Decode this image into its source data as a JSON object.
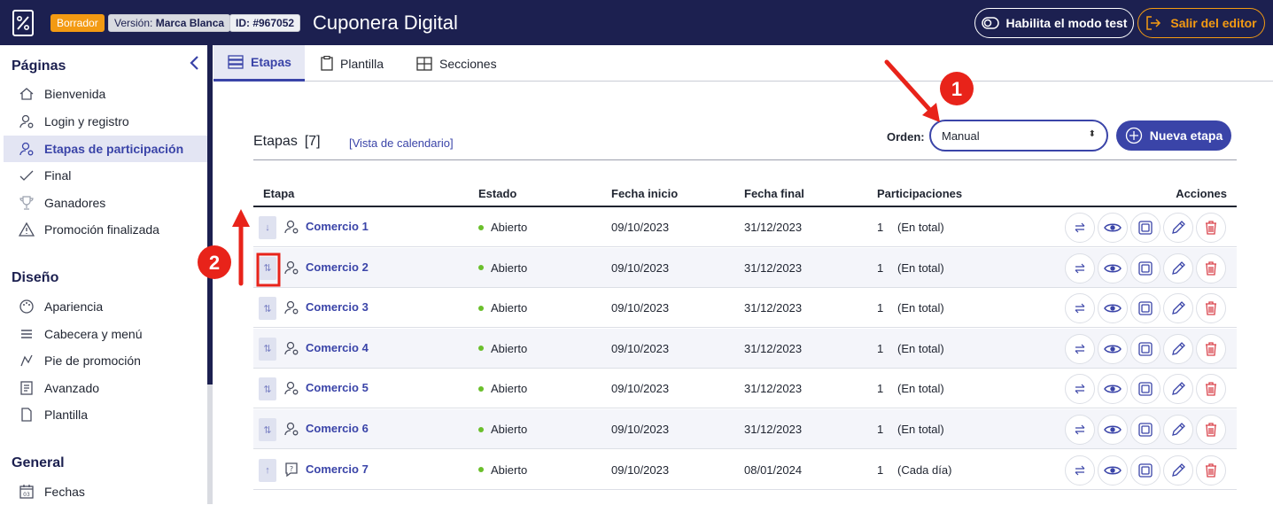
{
  "topbar": {
    "badge_draft": "Borrador",
    "badge_version_prefix": "Versión: ",
    "badge_version_value": "Marca Blanca",
    "badge_id": "ID: #967052",
    "app_title": "Cuponera Digital",
    "test_mode_label": "Habilita el modo test",
    "exit_label": "Salir del editor"
  },
  "sidebar": {
    "sections": [
      {
        "title": "Páginas"
      },
      {
        "title": "Diseño"
      },
      {
        "title": "General"
      }
    ],
    "pages": [
      {
        "label": "Bienvenida",
        "icon": "home-icon"
      },
      {
        "label": "Login y registro",
        "icon": "user-settings-icon"
      },
      {
        "label": "Etapas de participación",
        "icon": "user-settings-icon"
      },
      {
        "label": "Final",
        "icon": "check-icon"
      },
      {
        "label": "Ganadores",
        "icon": "trophy-icon"
      },
      {
        "label": "Promoción finalizada",
        "icon": "warning-icon"
      }
    ],
    "design": [
      {
        "label": "Apariencia",
        "icon": "palette-icon"
      },
      {
        "label": "Cabecera y menú",
        "icon": "menu-icon"
      },
      {
        "label": "Pie de promoción",
        "icon": "footer-icon"
      },
      {
        "label": "Avanzado",
        "icon": "code-icon"
      },
      {
        "label": "Plantilla",
        "icon": "file-icon"
      }
    ],
    "general": [
      {
        "label": "Fechas",
        "icon": "calendar-icon"
      }
    ],
    "calendar_day": "03"
  },
  "tabs": [
    {
      "label": "Etapas",
      "icon": "list-icon"
    },
    {
      "label": "Plantilla",
      "icon": "clipboard-icon"
    },
    {
      "label": "Secciones",
      "icon": "grid-icon"
    }
  ],
  "main": {
    "heading": "Etapas",
    "count": "[7]",
    "calendar_link": "[Vista de calendario]",
    "order_label": "Orden:",
    "order_value": "Manual",
    "new_button": "Nueva etapa"
  },
  "table": {
    "headers": [
      "Etapa",
      "Estado",
      "Fecha inicio",
      "Fecha final",
      "Participaciones",
      "Acciones"
    ],
    "rows": [
      {
        "name": "Comercio 1",
        "status": "Abierto",
        "start": "09/10/2023",
        "end": "31/12/2023",
        "count": "1",
        "scope": "(En total)",
        "handle": "↓",
        "icon": "user-settings-icon"
      },
      {
        "name": "Comercio 2",
        "status": "Abierto",
        "start": "09/10/2023",
        "end": "31/12/2023",
        "count": "1",
        "scope": "(En total)",
        "handle": "⇅",
        "icon": "user-settings-icon"
      },
      {
        "name": "Comercio 3",
        "status": "Abierto",
        "start": "09/10/2023",
        "end": "31/12/2023",
        "count": "1",
        "scope": "(En total)",
        "handle": "⇅",
        "icon": "user-settings-icon"
      },
      {
        "name": "Comercio 4",
        "status": "Abierto",
        "start": "09/10/2023",
        "end": "31/12/2023",
        "count": "1",
        "scope": "(En total)",
        "handle": "⇅",
        "icon": "user-settings-icon"
      },
      {
        "name": "Comercio 5",
        "status": "Abierto",
        "start": "09/10/2023",
        "end": "31/12/2023",
        "count": "1",
        "scope": "(En total)",
        "handle": "⇅",
        "icon": "user-settings-icon"
      },
      {
        "name": "Comercio 6",
        "status": "Abierto",
        "start": "09/10/2023",
        "end": "31/12/2023",
        "count": "1",
        "scope": "(En total)",
        "handle": "⇅",
        "icon": "user-settings-icon"
      },
      {
        "name": "Comercio 7",
        "status": "Abierto",
        "start": "09/10/2023",
        "end": "08/01/2024",
        "count": "1",
        "scope": "(Cada día)",
        "handle": "↑",
        "icon": "question-chat-icon"
      }
    ],
    "action_icons": [
      "swap-icon",
      "eye-icon",
      "duplicate-icon",
      "edit-icon",
      "trash-icon"
    ]
  },
  "annotations": {
    "marker_1": "1",
    "marker_2": "2",
    "accent_color": "#e8231a"
  },
  "colors": {
    "navy": "#1c2050",
    "primary": "#3a44a8",
    "orange": "#f39a12",
    "open_green": "#6abf2b",
    "delete_red": "#d9434c"
  }
}
